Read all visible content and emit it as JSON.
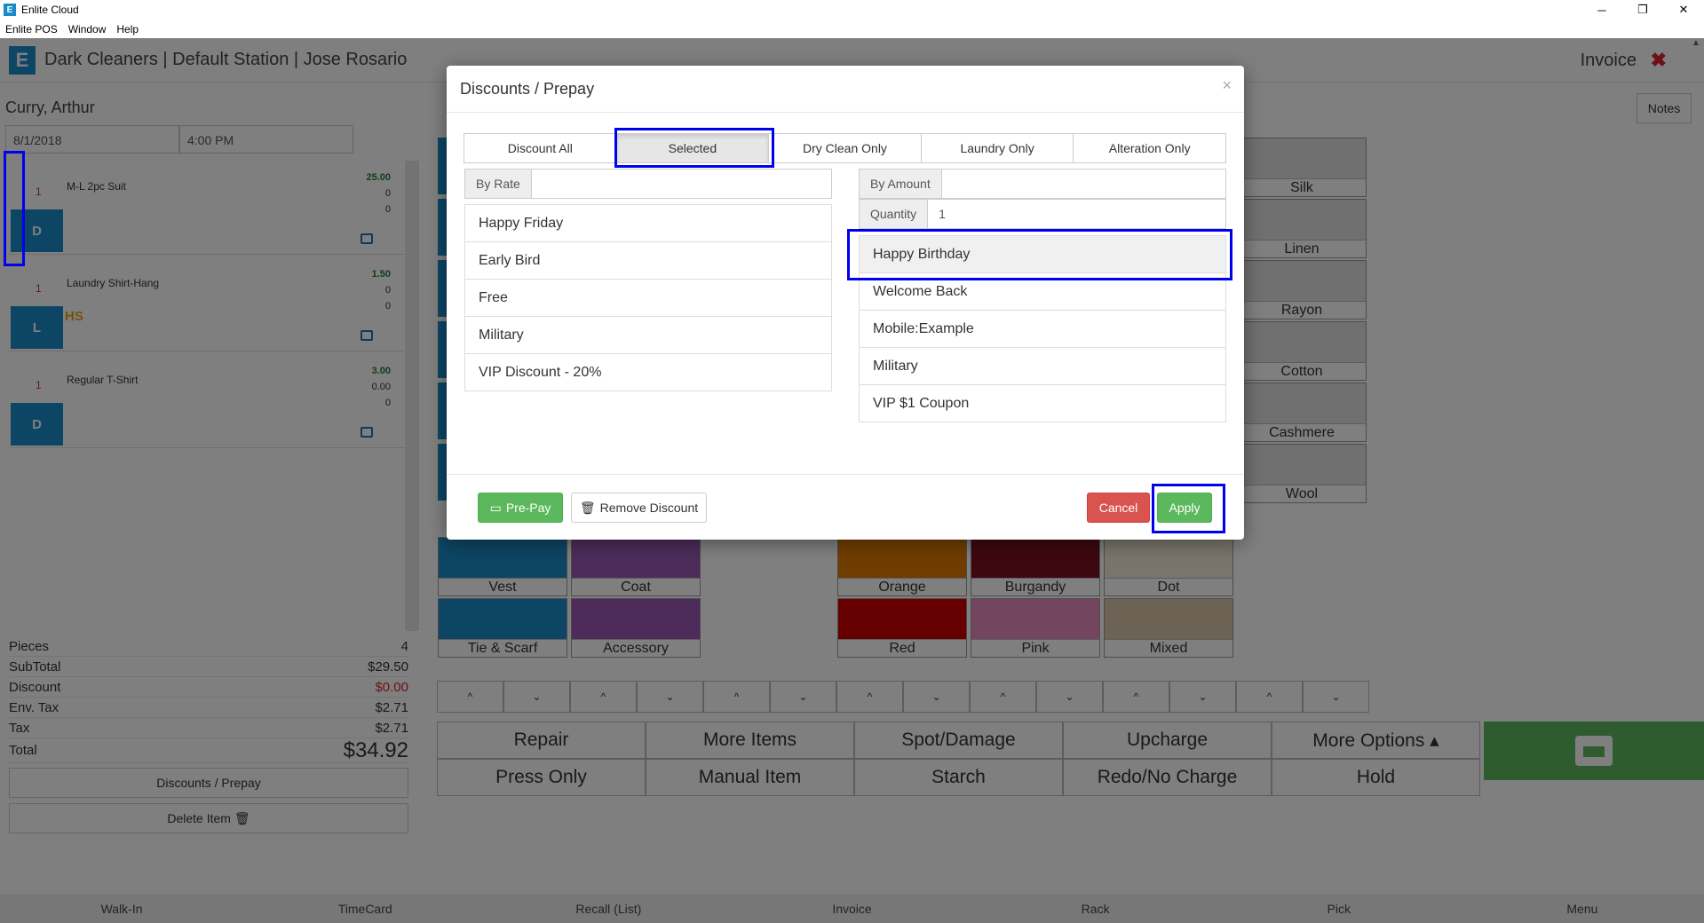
{
  "window": {
    "title": "Enlite Cloud",
    "app_logo_letter": "E",
    "minimize": "─",
    "restore": "❐",
    "close": "✕"
  },
  "menubar": [
    "Enlite POS",
    "Window",
    "Help"
  ],
  "header": {
    "logo_letter": "E",
    "title": "Dark Cleaners | Default Station | Jose Rosario",
    "invoice_label": "Invoice",
    "close_icon": "✖"
  },
  "customer": {
    "name": "Curry, Arthur",
    "date": "8/1/2018",
    "time": "4:00 PM"
  },
  "items": [
    {
      "qty": "1",
      "name": "M-L 2pc Suit",
      "price": "25.00",
      "p2": "0",
      "p3": "0",
      "badge": "D",
      "tag": ""
    },
    {
      "qty": "1",
      "name": "Laundry Shirt-Hang",
      "price": "1.50",
      "p2": "0",
      "p3": "0",
      "badge": "L",
      "tag": "HS"
    },
    {
      "qty": "1",
      "name": "Regular T-Shirt",
      "price": "3.00",
      "p2": "0.00",
      "p3": "0",
      "badge": "D",
      "tag": ""
    }
  ],
  "totals": {
    "pieces_label": "Pieces",
    "pieces": "4",
    "subtotal_label": "SubTotal",
    "subtotal": "$29.50",
    "discount_label": "Discount",
    "discount": "$0.00",
    "envtax_label": "Env. Tax",
    "envtax": "$2.71",
    "tax_label": "Tax",
    "tax": "$2.71",
    "total_label": "Total",
    "total": "$34.92"
  },
  "left_buttons": {
    "discounts": "Discounts / Prepay",
    "delete": "Delete Item 🗑"
  },
  "notes_button": "Notes",
  "fabric_tiles": [
    "Silk",
    "Linen",
    "Rayon",
    "Cotton",
    "Cashmere",
    "Wool"
  ],
  "garment_tiles": [
    "Vest",
    "Coat",
    "Tie & Scarf",
    "Accessory"
  ],
  "color_tiles": [
    {
      "label": "Orange",
      "color": "#e07b00"
    },
    {
      "label": "Burgandy",
      "color": "#7a1020"
    },
    {
      "label": "Dot",
      "color": "#f2e8d8"
    },
    {
      "label": "Red",
      "color": "#cc0000"
    },
    {
      "label": "Pink",
      "color": "#e68bbf"
    },
    {
      "label": "Mixed",
      "color": "#d8c6a8"
    }
  ],
  "arrow_up": "^",
  "arrow_down": "⌄",
  "actions": [
    "Repair",
    "More Items",
    "Spot/Damage",
    "Upcharge",
    "More Options ▴",
    "Press Only",
    "Manual Item",
    "Starch",
    "Redo/No Charge",
    "Hold"
  ],
  "bottom_nav": [
    "Walk-In",
    "TimeCard",
    "Recall (List)",
    "Invoice",
    "Rack",
    "Pick",
    "Menu"
  ],
  "modal": {
    "title": "Discounts / Prepay",
    "close": "×",
    "tabs": [
      "Discount All",
      "Selected",
      "Dry Clean Only",
      "Laundry Only",
      "Alteration Only"
    ],
    "active_tab": "Selected",
    "by_rate_label": "By Rate",
    "by_rate_value": "",
    "by_amount_label": "By Amount",
    "by_amount_value": "",
    "quantity_label": "Quantity",
    "quantity_value": "1",
    "rate_discounts": [
      "Happy Friday",
      "Early Bird",
      "Free",
      "Military",
      "VIP Discount - 20%"
    ],
    "amount_discounts": [
      "Happy Birthday",
      "Welcome Back",
      "Mobile:Example",
      "Military",
      "VIP $1 Coupon"
    ],
    "selected_amount_discount": "Happy Birthday",
    "prepay_label": "Pre-Pay",
    "remove_label": "Remove Discount",
    "cancel_label": "Cancel",
    "apply_label": "Apply"
  },
  "colors": {
    "brand_blue": "#1a8bc8",
    "success_green": "#5cb85c",
    "danger_red": "#d9534f",
    "highlight_blue": "#0000ee"
  }
}
